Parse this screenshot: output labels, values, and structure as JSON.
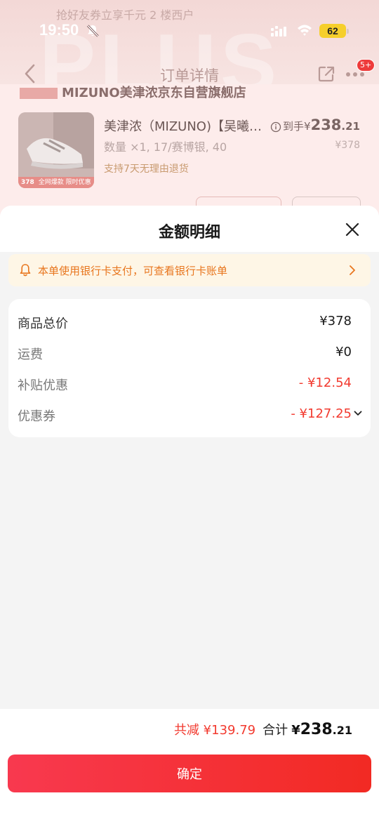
{
  "status_bar": {
    "time": "19:50",
    "battery": "62"
  },
  "background_page": {
    "top_banner": "抢好友券立享千元 2 楼西户",
    "watermark": "PLUS",
    "nav_title": "订单详情",
    "message_badge": "5+",
    "shop_name": "MIZUNO美津浓京东自营旗舰店",
    "product": {
      "name": "美津浓（MIZUNO)【吴曦…",
      "spec": "数量 ×1, 17/赛博银, 40",
      "return_policy": "支持7天无理由退货",
      "final_price_label": "到手¥",
      "final_price_int": "238",
      "final_price_dec": ".21",
      "original_price": "¥378",
      "image_price": "378",
      "image_caption": "全网爆款 限时优惠"
    }
  },
  "sheet": {
    "title": "金额明细",
    "notice": "本单使用银行卡支付，可查看银行卡账单",
    "rows": [
      {
        "label": "商品总价",
        "value": "¥378"
      },
      {
        "label": "运费",
        "value": "¥0"
      },
      {
        "label": "补贴优惠",
        "value": "- ¥12.54"
      },
      {
        "label": "优惠券",
        "value": "- ¥127.25"
      }
    ],
    "footer": {
      "reduce_text": "共减 ¥139.79",
      "total_label": "合计",
      "total_symbol": "¥",
      "total_int": "238",
      "total_dec": ".21",
      "confirm_label": "确定"
    }
  },
  "colors": {
    "accent_red": "#f23a2f",
    "notice_orange": "#e8761e",
    "notice_bg": "#fef6e6",
    "battery_yellow": "#f6cf2b"
  },
  "icons": [
    "bell-slash-icon",
    "signal-icon",
    "wifi-icon",
    "back-icon",
    "share-icon",
    "more-icon",
    "info-icon",
    "close-icon",
    "bell-icon",
    "chevron-right-icon",
    "chevron-down-icon"
  ]
}
